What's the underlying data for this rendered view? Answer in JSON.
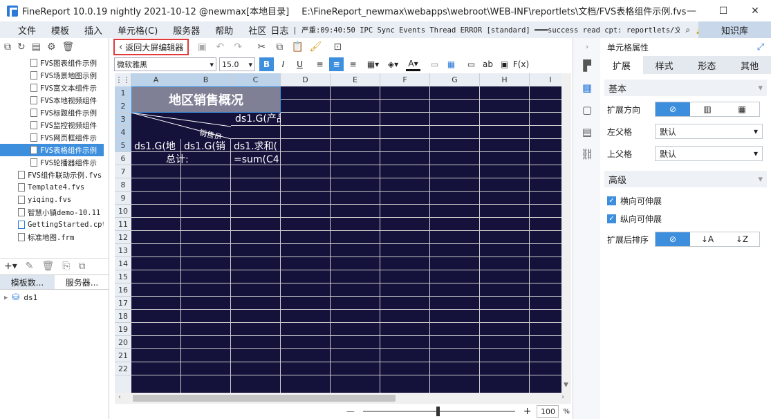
{
  "window": {
    "title": "FineReport 10.0.19 nightly 2021-10-12 @newmax[本地目录]",
    "path": "E:\\FineReport_newmax\\webapps\\webroot\\WEB-INF\\reportlets\\文档/FVS表格组件示例.fvs",
    "minimize": "—",
    "maximize": "☐",
    "close": "✕"
  },
  "menu": {
    "items": [
      "文件",
      "模板",
      "插入",
      "单元格(C)",
      "服务器",
      "帮助",
      "社区",
      "日志"
    ],
    "log": "| 严重:09:40:50 IPC Sync Events Thread ERROR [standard] ═══success read cpt: reportlets/文...",
    "knowledge": "知识库"
  },
  "toolbar": {
    "back_label": "返回大屏编辑器"
  },
  "format": {
    "font": "微软雅黑",
    "size": "15.0",
    "bold": "B",
    "italic": "I",
    "underline": "U",
    "fx": "F(x)",
    "ab": "ab"
  },
  "tree": {
    "items": [
      "FVS图表组件示例",
      "FVS场景地图示例",
      "FVS富文本组件示",
      "FVS本地视频组件",
      "FVS标题组件示例",
      "FVS监控视频组件",
      "FVS网页框组件示",
      "FVS表格组件示例",
      "FVS轮播器组件示",
      "FVS组件联动示例.fvs",
      "Template4.fvs",
      "yiqing.fvs",
      "智慧小镇demo-10.11",
      "GettingStarted.cpt",
      "标准地图.frm"
    ],
    "selected": 7
  },
  "left_tabs": {
    "datasets": "模板数...",
    "servers": "服务器..."
  },
  "dataset": {
    "name": "ds1"
  },
  "sheet": {
    "columns": [
      "A",
      "B",
      "C",
      "D",
      "E",
      "F",
      "G",
      "H",
      "I"
    ],
    "rows": [
      "1",
      "2",
      "3",
      "4",
      "5",
      "6",
      "7",
      "8",
      "9",
      "10",
      "11",
      "12",
      "13",
      "14",
      "15",
      "16",
      "17",
      "18",
      "19",
      "20",
      "21",
      "22"
    ],
    "title_cell": "地区销售概况",
    "c3": "ds1.G(产品)",
    "diag_label": "销售员",
    "a4": "ds1.G(地",
    "b4": "ds1.G(销",
    "c4": "ds1.求和(",
    "ab5": "总计:",
    "c5": "=sum(C4"
  },
  "status": {
    "zoom": "100",
    "pct": "%",
    "minus": "—",
    "plus": "+"
  },
  "props": {
    "title": "单元格属性",
    "tabs": [
      "扩展",
      "样式",
      "形态",
      "其他"
    ],
    "basic": "基本",
    "expand_dir": "扩展方向",
    "left_parent": "左父格",
    "left_parent_val": "默认",
    "top_parent": "上父格",
    "top_parent_val": "默认",
    "advanced": "高级",
    "h_expand": "横向可伸展",
    "v_expand": "纵向可伸展",
    "sort": "扩展后排序"
  }
}
